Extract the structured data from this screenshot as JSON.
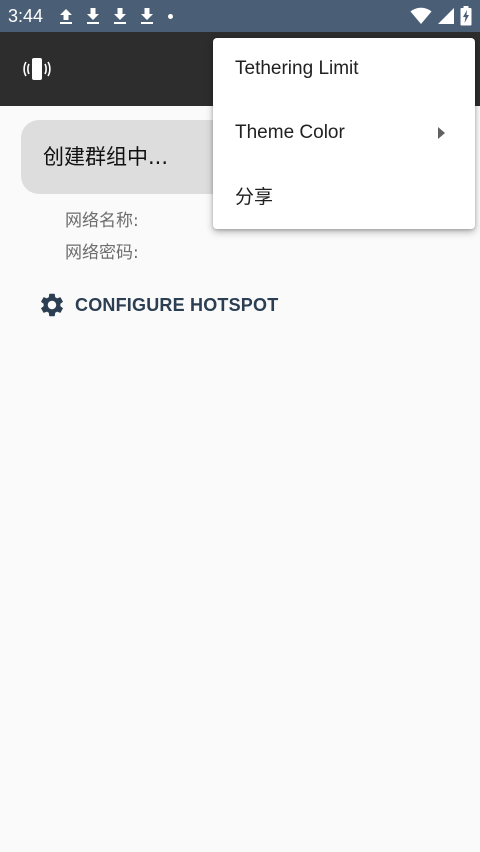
{
  "status_bar": {
    "time": "3:44",
    "left_icons": [
      "upload-icon",
      "download-icon",
      "download-icon",
      "download-icon",
      "notification-dot-icon"
    ],
    "right_icons": [
      "wifi-icon",
      "signal-icon",
      "battery-charging-icon"
    ]
  },
  "app_bar": {
    "logo_icon": "phone-vibrate-icon"
  },
  "main": {
    "status_text": "创建群组中...",
    "ssid_label": "网络名称:",
    "password_label": "网络密码:",
    "configure_button_label": "CONFIGURE HOTSPOT",
    "configure_icon": "gear-icon"
  },
  "menu": {
    "items": [
      {
        "label": "Tethering Limit",
        "has_submenu": false
      },
      {
        "label": "Theme Color",
        "has_submenu": true
      },
      {
        "label": "分享",
        "has_submenu": false
      }
    ]
  },
  "colors": {
    "status_bar_bg": "#4a5e75",
    "app_bar_bg": "#2d2d2d",
    "accent_text": "#2b3e52",
    "card_bg": "#dddddd"
  }
}
